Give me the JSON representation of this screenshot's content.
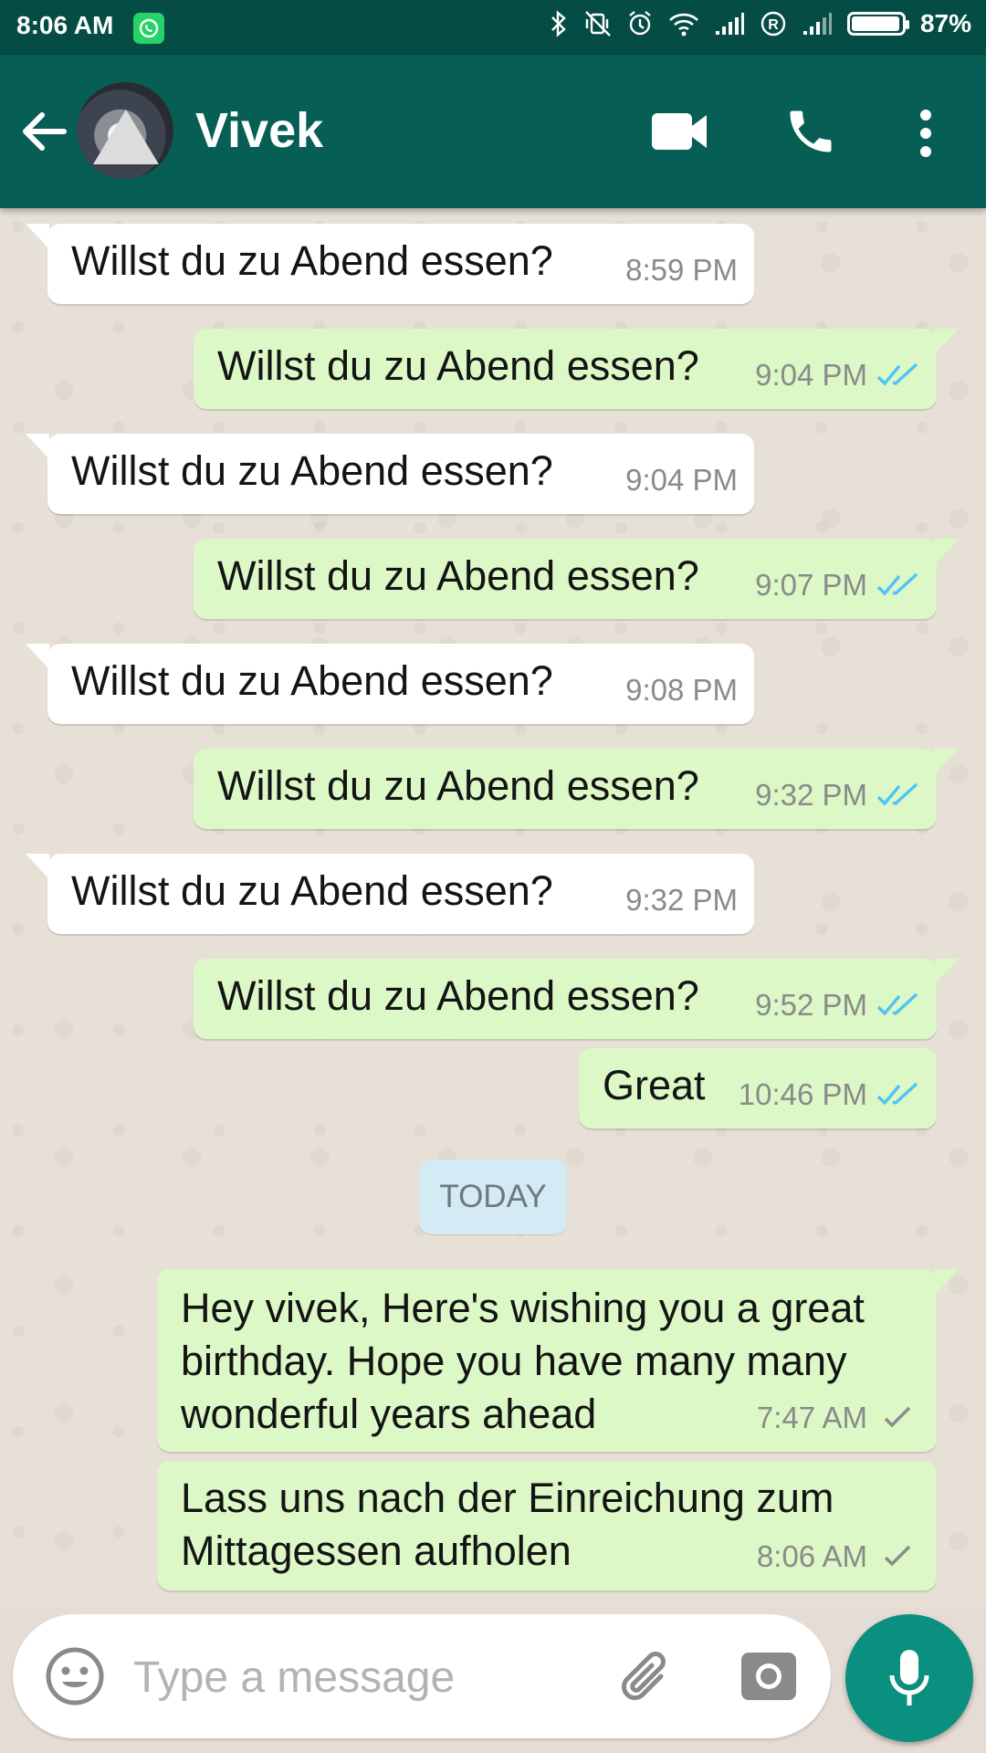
{
  "status_bar": {
    "time": "8:06 AM",
    "battery_percent": "87%",
    "icons": [
      "whatsapp-icon",
      "bluetooth-icon",
      "vibrate-off-icon",
      "alarm-icon",
      "wifi-icon",
      "signal-icon",
      "roaming-icon",
      "signal-icon",
      "battery-icon"
    ]
  },
  "header": {
    "contact_name": "Vivek",
    "actions": [
      "back-arrow-icon",
      "video-call-icon",
      "phone-icon",
      "more-vert-icon"
    ]
  },
  "messages": [
    {
      "direction": "in",
      "text": "Willst du zu Abend essen?",
      "time": "8:59 PM"
    },
    {
      "direction": "out",
      "text": "Willst du zu Abend essen?",
      "time": "9:04 PM",
      "status": "read"
    },
    {
      "direction": "in",
      "text": "Willst du zu Abend essen?",
      "time": "9:04 PM"
    },
    {
      "direction": "out",
      "text": "Willst du zu Abend essen?",
      "time": "9:07 PM",
      "status": "read"
    },
    {
      "direction": "in",
      "text": "Willst du zu Abend essen?",
      "time": "9:08 PM"
    },
    {
      "direction": "out",
      "text": "Willst du zu Abend essen?",
      "time": "9:32 PM",
      "status": "read"
    },
    {
      "direction": "in",
      "text": "Willst du zu Abend essen?",
      "time": "9:32 PM"
    },
    {
      "direction": "out",
      "text": "Willst du zu Abend essen?",
      "time": "9:52 PM",
      "status": "read"
    },
    {
      "direction": "out",
      "text": "Great",
      "time": "10:46 PM",
      "status": "read"
    },
    {
      "direction": "out",
      "text": "Hey vivek, Here's wishing you a great birthday. Hope you have many many wonderful years ahead",
      "time": "7:47 AM",
      "status": "sent"
    },
    {
      "direction": "out",
      "text": "Lass uns nach der Einreichung zum Mittagessen aufholen",
      "time": "8:06 AM",
      "status": "sent"
    }
  ],
  "date_separator": "TODAY",
  "composer": {
    "placeholder": "Type a message",
    "value": ""
  },
  "colors": {
    "header": "#075e54",
    "status_bar": "#054d44",
    "outgoing_bubble": "#dcf8c6",
    "incoming_bubble": "#ffffff",
    "read_tick": "#4fc3f7",
    "mic_button": "#0b8f7f"
  }
}
